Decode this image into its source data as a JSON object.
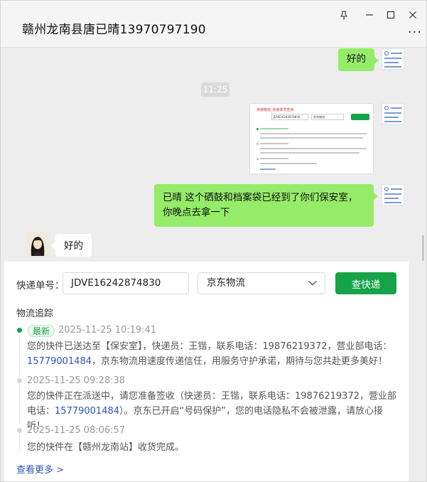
{
  "window": {
    "title": "赣州龙南县唐已晴13970797190",
    "controls": {
      "pin": "pin-icon",
      "minimize": "minimize-icon",
      "maximize": "maximize-icon",
      "close": "close-icon",
      "more": "···"
    }
  },
  "chat": {
    "messages": [
      {
        "side": "right",
        "type": "text",
        "text": "好的"
      },
      {
        "type": "time",
        "text": "11:25"
      },
      {
        "side": "right",
        "type": "screenshot"
      },
      {
        "side": "right",
        "type": "text",
        "line1": "已晴  这个硒鼓和档案袋已经到了你们保安室，",
        "line2": "你晚点去拿一下"
      },
      {
        "side": "left",
        "type": "text",
        "text": "好的"
      }
    ],
    "thumb": {
      "title": "快递物流_快递单号查询",
      "input": "JDVE16242874830",
      "select": "京东物流"
    }
  },
  "express": {
    "label_no": "快递单号：",
    "tracking_no": "JDVE16242874830",
    "company": "京东物流",
    "query_button": "查快递",
    "section_title": "物流追踪",
    "badge_new": "最新",
    "events": [
      {
        "time": "2025-11-25 10:19:41",
        "part1": "您的快件已送达至【保安室】，快递员：王锴，联系电话：19876219372，营业部电话：",
        "phone": "15779001484",
        "part2": "，京东物流用速度传递信任，用服务守护承诺，期待与您共赴更多美好！",
        "latest": true
      },
      {
        "time": "2025-11-25 09:28:38",
        "part1": "您的快件正在派送中，请您准备签收（快递员：王锴，联系电话：19876219372，营业部电",
        "part1b": "话：",
        "phone": "15779001484",
        "part2": "）。京东已开启“号码保护”，您的电话隐私不会被泄露，请放心接听！",
        "latest": false
      },
      {
        "time": "2025-11-25 08:06:57",
        "part1": "您的快件在【赣州龙南站】收货完成。",
        "latest": false
      }
    ],
    "more_link": "查看更多 >"
  },
  "colors": {
    "accent_green": "#16a34a",
    "bubble_green": "#95ec69",
    "link_blue": "#2f55b4"
  }
}
